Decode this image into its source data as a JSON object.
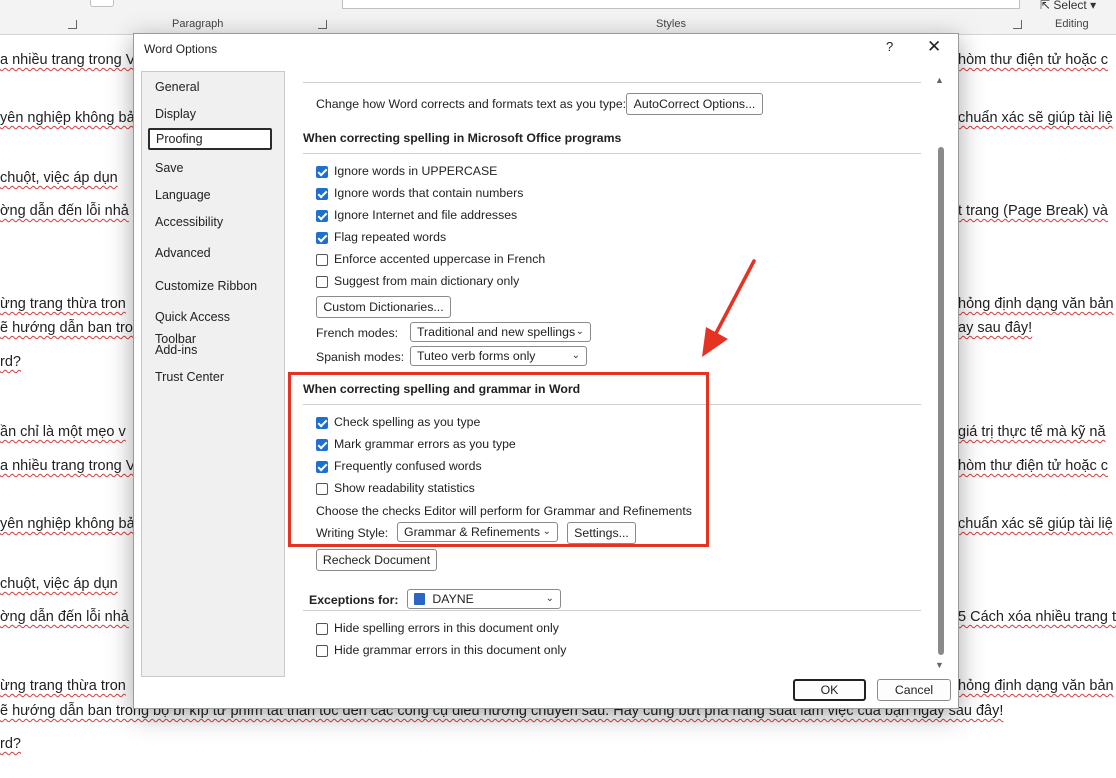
{
  "ribbon": {
    "paragraph_label": "Paragraph",
    "styles_label": "Styles",
    "editing_label": "Editing",
    "select_label": "Select"
  },
  "document": {
    "lines": [
      {
        "left": "a nhiều trang trong V",
        "right": "hòm thư điện tử hoặc c"
      },
      {
        "left": "yên nghiệp không bả",
        "right": "chuẩn xác sẽ giúp tài liệ"
      },
      {
        "left": " chuột, việc áp dụn",
        "right": ""
      },
      {
        "left": "ờng dẫn đến lỗi nhả",
        "right": "t trang (Page Break) và"
      },
      {
        "left": "ừng trang thừa tron",
        "right": "hỏng định dạng văn bản"
      },
      {
        "left": "ẽ hướng dẫn ban tro",
        "right": "ay sau đây!"
      },
      {
        "left": "rd?",
        "right": ""
      },
      {
        "left": "ần chỉ là một mẹo v",
        "right": "giá trị thực tế mà kỹ nă"
      },
      {
        "left": "a nhiều trang trong V",
        "right": "hòm thư điện tử hoặc c"
      },
      {
        "left": "yên nghiệp không bả",
        "right": "chuẩn xác sẽ giúp tài liệ"
      },
      {
        "left": " chuột, việc áp dụn",
        "right": ""
      },
      {
        "left": "ờng dẫn đến lỗi nhả",
        "right": "5 Cách xóa nhiều trang t"
      },
      {
        "left": "ừng trang thừa tron",
        "right": "hỏng định dạng văn bản"
      },
      {
        "left": "ẽ hướng dẫn ban trong bộ bí kíp từ phím tắt thần tốc đến các công cụ điều hướng chuyên sâu. Hãy cùng bứt phá năng suất làm việc của bạn ngay sau đây!",
        "right": ""
      },
      {
        "left": "rd?",
        "right": ""
      }
    ]
  },
  "dialog": {
    "title": "Word Options",
    "help": "?",
    "close": "✕",
    "nav": [
      "General",
      "Display",
      "Proofing",
      "Save",
      "Language",
      "Accessibility",
      "Advanced",
      "Customize Ribbon",
      "Quick Access Toolbar",
      "Add-ins",
      "Trust Center"
    ],
    "selected_nav": "Proofing",
    "autocorrect": {
      "text": "Change how Word corrects and formats text as you type:",
      "button": "AutoCorrect Options..."
    },
    "office_section": {
      "heading": "When correcting spelling in Microsoft Office programs",
      "options": [
        {
          "label": "Ignore words in UPPERCASE",
          "checked": true
        },
        {
          "label": "Ignore words that contain numbers",
          "checked": true
        },
        {
          "label": "Ignore Internet and file addresses",
          "checked": true
        },
        {
          "label": "Flag repeated words",
          "checked": true
        },
        {
          "label": "Enforce accented uppercase in French",
          "checked": false
        },
        {
          "label": "Suggest from main dictionary only",
          "checked": false
        }
      ],
      "custom_dictionaries": "Custom Dictionaries...",
      "french_modes_label": "French modes:",
      "french_modes_value": "Traditional and new spellings",
      "spanish_modes_label": "Spanish modes:",
      "spanish_modes_value": "Tuteo verb forms only"
    },
    "word_section": {
      "heading": "When correcting spelling and grammar in Word",
      "options": [
        {
          "label": "Check spelling as you type",
          "checked": true
        },
        {
          "label": "Mark grammar errors as you type",
          "checked": true
        },
        {
          "label": "Frequently confused words",
          "checked": true
        },
        {
          "label": "Show readability statistics",
          "checked": false
        }
      ],
      "checks_text": "Choose the checks Editor will perform for Grammar and Refinements",
      "writing_style_label": "Writing Style:",
      "writing_style_value": "Grammar & Refinements",
      "settings_button": "Settings...",
      "recheck_button": "Recheck Document"
    },
    "exceptions": {
      "label": "Exceptions for:",
      "document": "DAYNE",
      "options": [
        {
          "label": "Hide spelling errors in this document only",
          "checked": false
        },
        {
          "label": "Hide grammar errors in this document only",
          "checked": false
        }
      ]
    },
    "ok": "OK",
    "cancel": "Cancel"
  },
  "colors": {
    "annotation": "#e53222",
    "checkbox_accent": "#1f6fd0"
  }
}
